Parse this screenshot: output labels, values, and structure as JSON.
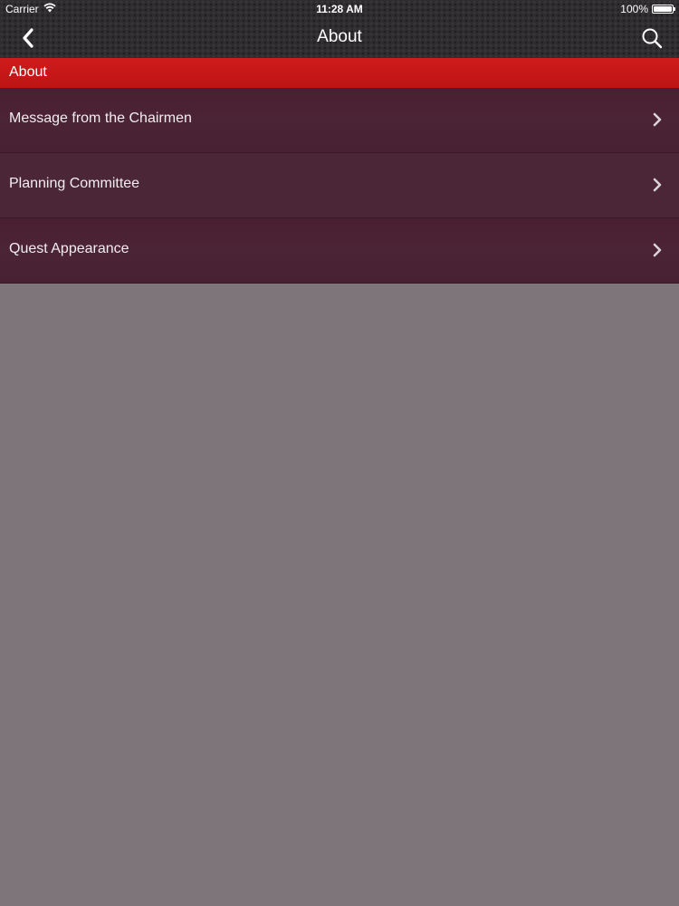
{
  "status_bar": {
    "carrier": "Carrier",
    "time": "11:28 AM",
    "battery": "100%"
  },
  "nav_bar": {
    "title": "About",
    "back_icon": "chevron-left-icon",
    "search_icon": "search-icon"
  },
  "section": {
    "title": "About"
  },
  "list": {
    "items": [
      {
        "label": "Message from the Chairmen"
      },
      {
        "label": "Planning Committee"
      },
      {
        "label": "Quest Appearance"
      }
    ]
  },
  "colors": {
    "section_header": "#c8181a",
    "list_bg": "#4a2133",
    "page_bg": "#7e757b"
  }
}
